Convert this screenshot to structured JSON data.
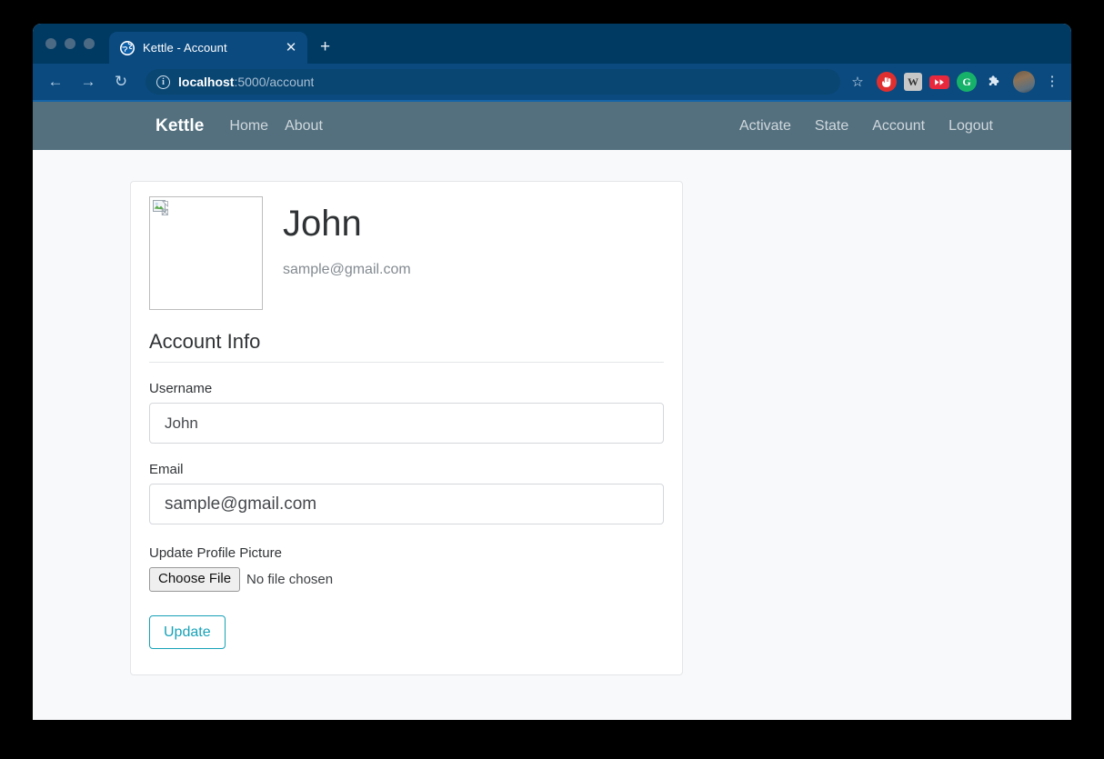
{
  "browser": {
    "tab": {
      "title": "Kettle - Account",
      "favicon": "globe-icon",
      "close_label": "✕"
    },
    "new_tab_label": "+",
    "back_label": "←",
    "forward_label": "→",
    "reload_label": "↻",
    "site_info_label": "i",
    "url_host": "localhost",
    "url_path": ":5000/account",
    "star_label": "☆",
    "extensions": [
      {
        "name": "adblock-icon",
        "glyph": "✋"
      },
      {
        "name": "wikipedia-icon",
        "glyph": "W"
      },
      {
        "name": "video-downloader-icon",
        "glyph": "▶▶"
      },
      {
        "name": "grammarly-icon",
        "glyph": "G"
      },
      {
        "name": "extensions-puzzle-icon",
        "glyph": "❖"
      }
    ],
    "avatar_name": "profile-avatar",
    "menu_label": "⋮",
    "colors": {
      "tab_strip": "#003a63",
      "toolbar": "#0b4a7f",
      "omnibox": "#0a4672"
    }
  },
  "site": {
    "navbar": {
      "brand": "Kettle",
      "left_links": [
        {
          "label": "Home"
        },
        {
          "label": "About"
        }
      ],
      "right_links": [
        {
          "label": "Activate"
        },
        {
          "label": "State"
        },
        {
          "label": "Account"
        },
        {
          "label": "Logout"
        }
      ],
      "background_color": "#54707f"
    },
    "account": {
      "profile_image": "broken-image-placeholder",
      "username_heading": "John",
      "email_text": "sample@gmail.com",
      "legend": "Account Info",
      "fields": {
        "username_label": "Username",
        "username_value": "John",
        "email_label": "Email",
        "email_value": "sample@gmail.com"
      },
      "file_upload": {
        "label": "Update Profile Picture",
        "button_label": "Choose File",
        "status_text": "No file chosen"
      },
      "submit_label": "Update",
      "accent_color": "#17a2b8"
    }
  }
}
